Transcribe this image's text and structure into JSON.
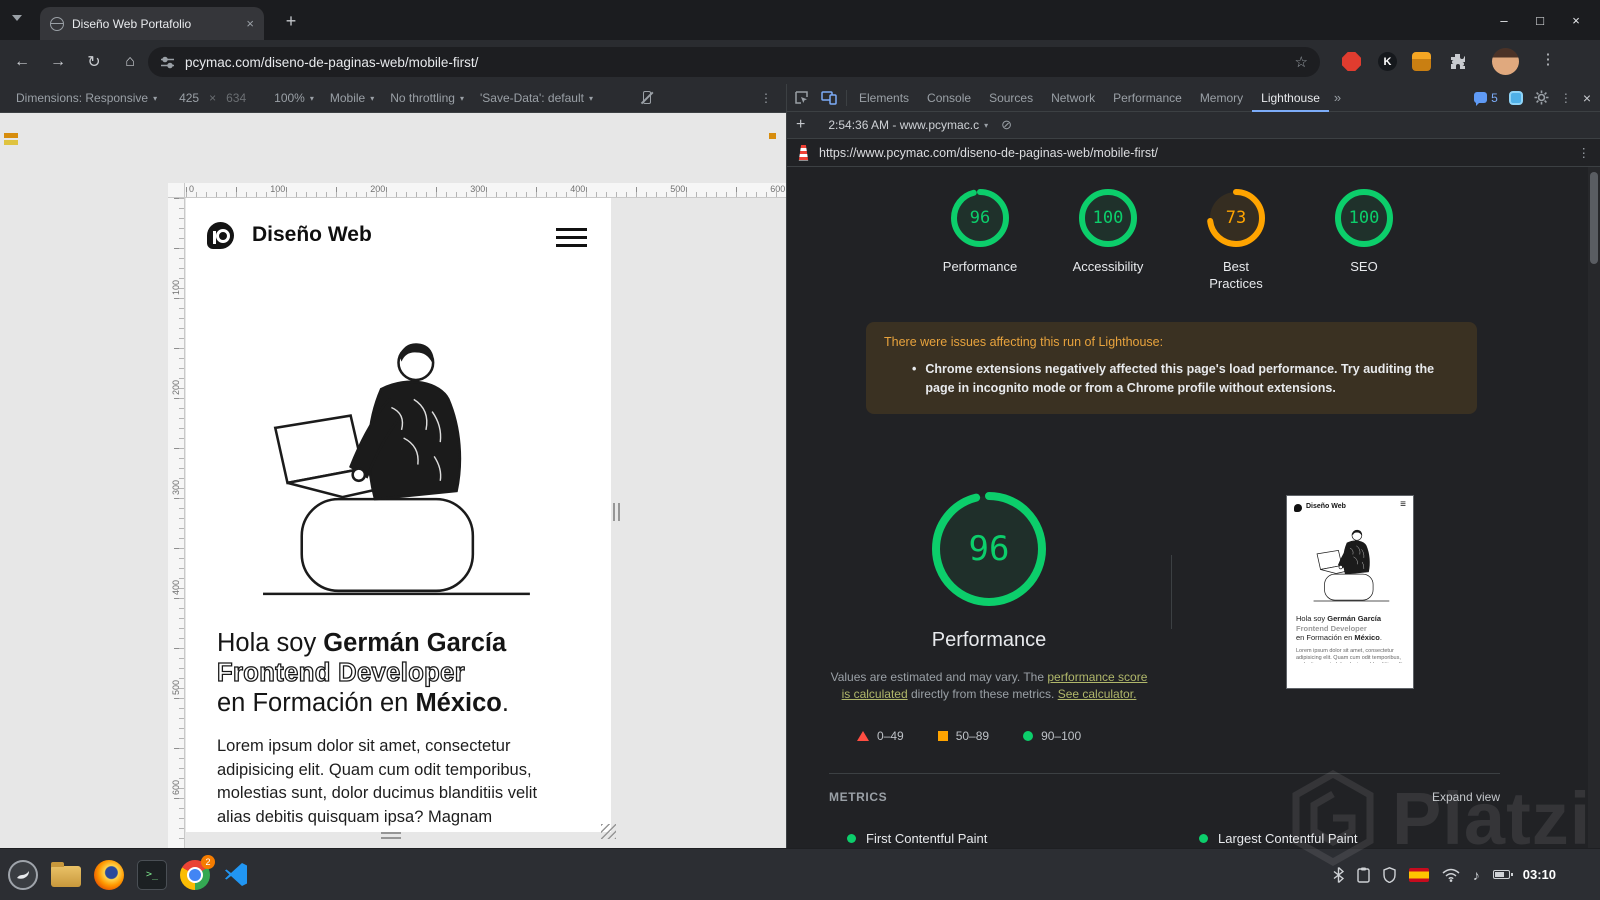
{
  "theme": {
    "green": "#0cce6b",
    "orange": "#ffa400",
    "red": "#ff4e42",
    "accent_blue": "#7cacf8"
  },
  "browser": {
    "tab_title": "Diseño Web Portafolio",
    "url": "pcymac.com/diseno-de-paginas-web/mobile-first/"
  },
  "icons": {
    "chevron": "▾",
    "close": "×",
    "minimize": "–",
    "maximize": "□",
    "plus": "+",
    "back": "←",
    "forward": "→",
    "reload": "↻",
    "home": "⌂",
    "star": "☆",
    "kebab": "⋮",
    "block": "⊘",
    "more": "»",
    "burger": "≡",
    "note": "♪",
    "bullet": "•",
    "times": "×",
    "prompt": ">_",
    "ext_k": "K"
  },
  "device_toolbar": {
    "dimensions": "Dimensions: Responsive",
    "width": "425",
    "height": "634",
    "zoom": "100%",
    "mode": "Mobile",
    "throttle": "No throttling",
    "save_data": "'Save-Data': default"
  },
  "ruler": {
    "h": [
      "0",
      "100",
      "200",
      "300",
      "400",
      "500",
      "600"
    ],
    "v": [
      "100",
      "200",
      "300",
      "400",
      "500",
      "600"
    ]
  },
  "page": {
    "logo_text": "Diseño Web",
    "headline_1_normal": "Hola soy ",
    "headline_1_bold": "Germán García",
    "headline_2": "Frontend Developer",
    "headline_3_normal": "en Formación en ",
    "headline_3_bold": "México",
    "headline_3_end": ".",
    "paragraph": "Lorem ipsum dolor sit amet, consectetur adipisicing elit. Quam cum odit temporibus, molestias sunt, dolor ducimus blanditiis velit alias debitis quisquam ipsa? Magnam"
  },
  "devtools": {
    "tabs": [
      "Elements",
      "Console",
      "Sources",
      "Network",
      "Performance",
      "Memory",
      "Lighthouse"
    ],
    "issues_count": "5",
    "run_time": "2:54:36 AM - www.pcymac.c",
    "report_url": "https://www.pcymac.com/diseno-de-paginas-web/mobile-first/"
  },
  "lighthouse": {
    "scores": [
      {
        "label": "Performance",
        "value": "96"
      },
      {
        "label": "Accessibility",
        "value": "100"
      },
      {
        "label": "Best Practices",
        "value": "73"
      },
      {
        "label": "SEO",
        "value": "100"
      }
    ],
    "warning_title": "There were issues affecting this run of Lighthouse:",
    "warning_item": "Chrome extensions negatively affected this page's load performance. Try auditing the page in incognito mode or from a Chrome profile without extensions.",
    "gauge_value": "96",
    "gauge_label": "Performance",
    "disclaimer_pre": "Values are estimated and may vary. The ",
    "disclaimer_link1": "performance score is calculated",
    "disclaimer_mid": " directly from these metrics. ",
    "disclaimer_link2": "See calculator.",
    "legend": [
      {
        "label": "0–49",
        "color": "#ff4e42"
      },
      {
        "label": "50–89",
        "color": "#ffa400"
      },
      {
        "label": "90–100",
        "color": "#0cce6b"
      }
    ],
    "metrics_title": "METRICS",
    "expand_view": "Expand view",
    "metrics": [
      "First Contentful Paint",
      "Largest Contentful Paint"
    ]
  },
  "taskbar": {
    "chrome_badge": "2",
    "clock": "03:10"
  },
  "watermark": "Platzi"
}
